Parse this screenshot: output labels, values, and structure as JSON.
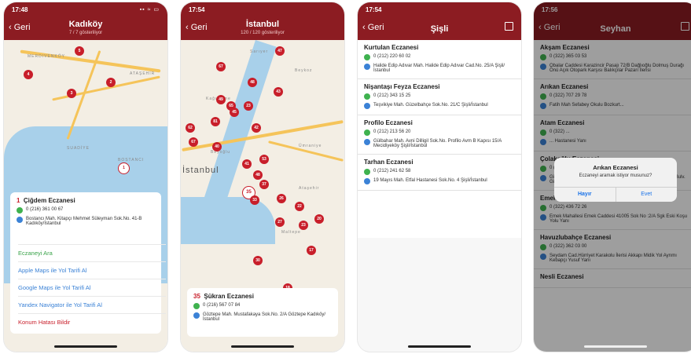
{
  "screens": [
    {
      "status_time": "17:48",
      "status_icons": "▪▪ ≈ ▭",
      "back_label": "Geri",
      "title": "Kadıköy",
      "subtitle": "7 / 7 gösteriliyor",
      "selected": {
        "number": "1",
        "name": "Çiğdem Eczanesi",
        "phone": "0 (216) 361 00 67",
        "address": "Bostancı Mah. Kitapçı Mehmet Süleyman Sok.No. 41-B Kadıköy/İstanbul"
      },
      "actions": [
        "Eczaneyi Ara",
        "Apple Maps ile Yol Tarifi Al",
        "Google Maps ile Yol Tarifi Al",
        "Yandex Navigator ile Yol Tarifi Al",
        "Konum Hatası Bildir"
      ],
      "map_labels": [
        "MERDIVENKÖY",
        "ATAŞEHİR",
        "SUADİYE",
        "BOSTANCI"
      ],
      "pins": [
        "4",
        "5",
        "3",
        "2",
        "1"
      ]
    },
    {
      "status_time": "17:54",
      "back_label": "Geri",
      "title": "İstanbul",
      "subtitle": "120 / 120 gösteriliyor",
      "map_labels": [
        "Sarıyer",
        "Beykoz",
        "Kağıthane",
        "Beyoğlu",
        "İstanbul",
        "Ataşehir",
        "Maltepe",
        "Ümraniye"
      ],
      "pins": [
        "47",
        "67",
        "48",
        "43",
        "49",
        "65",
        "23",
        "45",
        "62",
        "81",
        "42",
        "67",
        "40",
        "41",
        "53",
        "48",
        "37",
        "35",
        "33",
        "26",
        "22",
        "27",
        "23",
        "20",
        "17",
        "30",
        "18"
      ],
      "selected": {
        "number": "35",
        "name": "Şükran Eczanesi",
        "phone": "0 (216) 567 07 84",
        "address": "Göztepe Mah. Mustafakaya Sok.No. 2/A Göztepe Kadıköy/İstanbul"
      }
    },
    {
      "status_time": "17:54",
      "back_label": "Geri",
      "title": "Şişli",
      "items": [
        {
          "name": "Kurtulan Eczanesi",
          "phone": "0 (212) 220 60 02",
          "address": "Halide Edip Adıvar Mah. Halide Edip Adıvar Cad.No. 25/A Şişli/İstanbul"
        },
        {
          "name": "Nişantaşı Feyza Eczanesi",
          "phone": "0 (212) 343 15 25",
          "address": "Teşvikiye Mah. Güzelbahçe Sok.No. 21/C Şişli/İstanbul"
        },
        {
          "name": "Profilo Eczanesi",
          "phone": "0 (212) 213 56 20",
          "address": "Gülbahar Mah. Avni Dilligil Sok.No. Profilo Avm B Kapısı 15/A Mecidiyeköy Şişli/İstanbul"
        },
        {
          "name": "Tarhan Eczanesi",
          "phone": "0 (212) 241 62 58",
          "address": "19 Mayıs Mah. Etfal Hastanesi Sok.No. 4 Şişli/İstanbul"
        }
      ]
    },
    {
      "status_time": "17:56",
      "back_label": "Geri",
      "title": "Seyhan",
      "items": [
        {
          "name": "Akşam Eczanesi",
          "phone": "0 (322) 365 03 53",
          "address": "Obalar Caddesi Karazincir Pasajı 72/B Dağlıoğlu Dolmuş Durağı Önü Açık Otopark Karşısı Balıkçılar Pazarı İlerisi"
        },
        {
          "name": "Arıkan Eczanesi",
          "phone": "0 (322) 707 29 78",
          "address": "Fatih Mah Sefabey Okulu Bozkurt..."
        },
        {
          "name": "Atam Eczanesi",
          "phone": "0 (322) ...",
          "address": "... Hastanesi Yanı"
        },
        {
          "name": "Çolakoğlu Eczanesi",
          "phone": "0 (322) 261 61 63",
          "address": "Gürselpaşa Mah. 75710 Sok. Umut Apt.(Aliya İzzet Begoviç Bulv. Gürselpaşa Migros Arkası)"
        },
        {
          "name": "Emek Eczanesi",
          "phone": "0 (322) 436 72 26",
          "address": "Emek Mahallesi Emek Caddesi 41005 Sok No :2/A Sgk Eski Koşu Yolu Yanı"
        },
        {
          "name": "Havuzlubahçe Eczanesi",
          "phone": "0 (322) 362 03 00",
          "address": "Seydam Cad.Hürriyet Karakolu İlerisi Akkapı Midik Yol Ayrımı Kebapçı Yusuf Yanı"
        },
        {
          "name": "Nesli Eczanesi",
          "phone": "",
          "address": ""
        }
      ],
      "dialog": {
        "title": "Arıkan Eczanesi",
        "message": "Eczaneyi aramak istiyor musunuz?",
        "cancel": "Hayır",
        "confirm": "Evet"
      }
    }
  ]
}
